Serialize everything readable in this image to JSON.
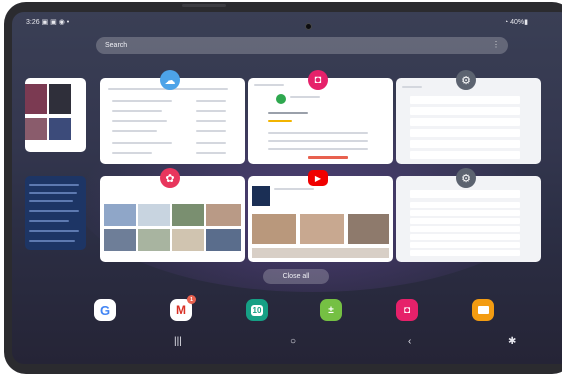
{
  "status_bar": {
    "time": "3:26",
    "battery": "40%"
  },
  "search": {
    "placeholder": "Search"
  },
  "recent_apps": [
    {
      "name": "Weather",
      "icon": "sun-cloud-icon",
      "color": "#4da3e8"
    },
    {
      "name": "Galaxy Store",
      "icon": "shopping-bag-icon",
      "color": "#e6216a"
    },
    {
      "name": "Settings",
      "icon": "gear-icon",
      "color": "#5c6370"
    },
    {
      "name": "Gallery",
      "icon": "flower-icon",
      "color": "#e8365d"
    },
    {
      "name": "YouTube",
      "icon": "play-icon",
      "color": "#f00000"
    },
    {
      "name": "Settings",
      "icon": "gear-icon",
      "color": "#5c6370"
    }
  ],
  "close_all_label": "Close all",
  "dock": [
    {
      "name": "Google",
      "icon": "google-icon",
      "color": "#ffffff"
    },
    {
      "name": "Gmail",
      "icon": "gmail-icon",
      "color": "#ffffff",
      "badge": "1"
    },
    {
      "name": "Calendar",
      "icon": "calendar-icon",
      "color": "#16a085",
      "day": "10"
    },
    {
      "name": "Calculator",
      "icon": "calculator-icon",
      "color": "#75c043"
    },
    {
      "name": "Galaxy Store",
      "icon": "shopping-bag-icon",
      "color": "#e6216a"
    },
    {
      "name": "Samsung Notes",
      "icon": "folder-icon",
      "color": "#f39c12"
    }
  ],
  "nav": {
    "recents": "|||",
    "home": "○",
    "back": "‹",
    "accessibility": "✱"
  }
}
